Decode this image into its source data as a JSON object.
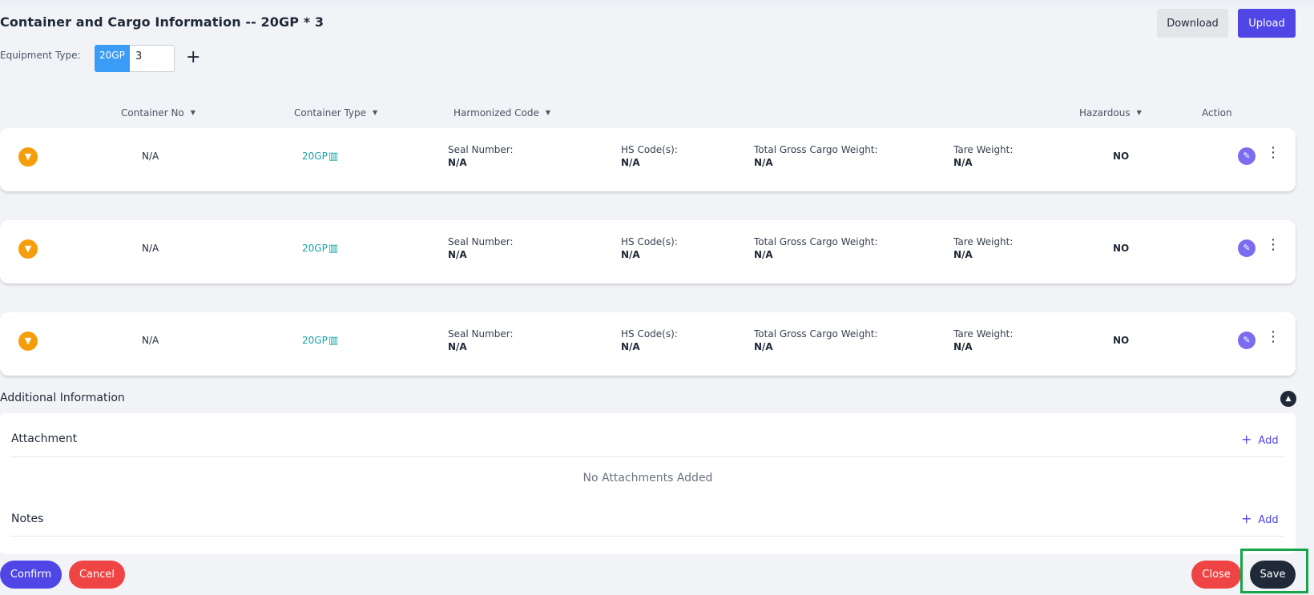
{
  "header": {
    "title": "Container and Cargo Information -- 20GP * 3",
    "download_label": "Download",
    "upload_label": "Upload"
  },
  "equipment": {
    "label": "Equipment Type:",
    "tag": "20GP",
    "quantity": "3",
    "add_symbol": "+"
  },
  "columns": {
    "container_no": "Container No",
    "container_type": "Container Type",
    "harmonized_code": "Harmonized Code",
    "hazardous": "Hazardous",
    "action": "Action"
  },
  "field_labels": {
    "seal": "Seal Number:",
    "hs": "HS Code(s):",
    "gross": "Total Gross Cargo Weight:",
    "tare": "Tare Weight:"
  },
  "rows": [
    {
      "container_no": "N/A",
      "container_type": "20GP",
      "seal": "N/A",
      "hs": "N/A",
      "gross": "N/A",
      "tare": "N/A",
      "hazardous": "NO"
    },
    {
      "container_no": "N/A",
      "container_type": "20GP",
      "seal": "N/A",
      "hs": "N/A",
      "gross": "N/A",
      "tare": "N/A",
      "hazardous": "NO"
    },
    {
      "container_no": "N/A",
      "container_type": "20GP",
      "seal": "N/A",
      "hs": "N/A",
      "gross": "N/A",
      "tare": "N/A",
      "hazardous": "NO"
    }
  ],
  "additional": {
    "title": "Additional Information",
    "attachment_title": "Attachment",
    "attachment_add": "Add",
    "attachment_empty": "No Attachments Added",
    "notes_title": "Notes",
    "notes_add": "Add"
  },
  "footer": {
    "confirm_label": "Confirm",
    "cancel_label": "Cancel",
    "close_label": "Close",
    "save_label": "Save"
  },
  "colors": {
    "primary": "#4f46e5",
    "danger": "#ef4444",
    "accent_teal": "#14a3a3",
    "expand_orange": "#f59e0b",
    "highlight_green": "#16a34a"
  },
  "icons": {
    "expand": "chevron-down-icon",
    "container_type": "container-icon",
    "edit": "pencil-icon",
    "more": "more-vertical-icon",
    "collapse": "chevron-up-icon",
    "add": "plus-icon"
  }
}
